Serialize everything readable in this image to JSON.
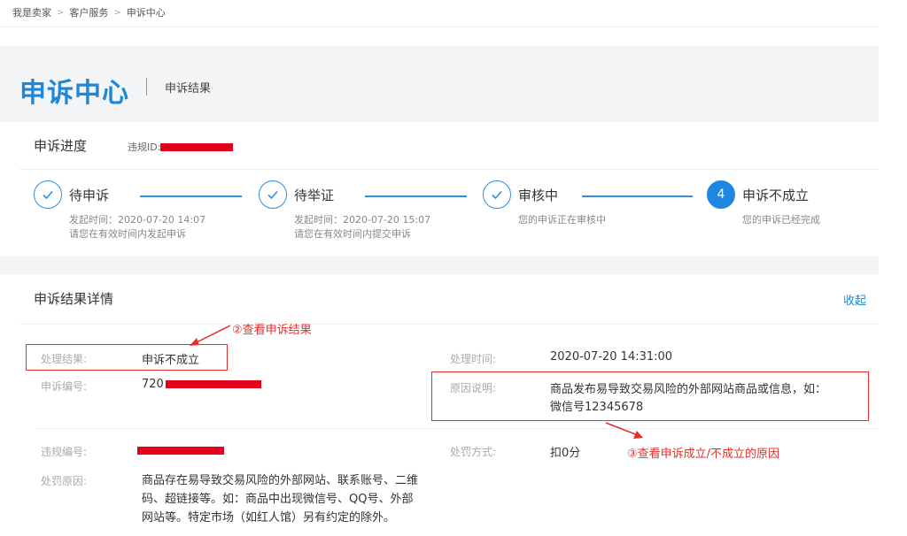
{
  "breadcrumb": {
    "items": [
      "我是卖家",
      "客户服务",
      "申诉中心"
    ],
    "separator": ">"
  },
  "header": {
    "title": "申诉中心",
    "subtitle": "申诉结果"
  },
  "progress": {
    "title": "申诉进度",
    "violation_id_label": "违规ID:",
    "steps": [
      {
        "name": "待申诉",
        "line1": "发起时间：2020-07-20 14:07",
        "line2": "请您在有效时间内发起申诉"
      },
      {
        "name": "待举证",
        "line1": "发起时间：2020-07-20 15:07",
        "line2": "请您在有效时间内提交申诉"
      },
      {
        "name": "审核中",
        "line1": "您的申诉正在审核中",
        "line2": ""
      },
      {
        "name": "申诉不成立",
        "number": "4",
        "line1": "您的申诉已经完成",
        "line2": ""
      }
    ]
  },
  "detail": {
    "title": "申诉结果详情",
    "collapse_label": "收起",
    "result_label": "处理结果:",
    "result_value": "申诉不成立",
    "time_label": "处理时间:",
    "time_value": "2020-07-20 14:31:00",
    "appeal_no_label": "申诉编号:",
    "appeal_no_value": "720",
    "reason_label": "原因说明:",
    "reason_line1": "商品发布易导致交易风险的外部网站商品或信息，如：",
    "reason_line2": "微信号12345678",
    "violation_no_label": "违规编号:",
    "penalty_method_label": "处罚方式:",
    "penalty_method_value": "扣0分",
    "penalty_reason_label": "处罚原因:",
    "penalty_reason_lines": [
      "商品存在易导致交易风险的外部网站、联系账号、二维",
      "码、超链接等。如：商品中出现微信号、QQ号、外部",
      "网站等。特定市场（如红人馆）另有约定的除外。"
    ]
  },
  "annotations": {
    "note2": "②查看申诉结果",
    "note3": "③查看申诉成立/不成立的原因",
    "color": "#e3302d"
  },
  "colors": {
    "accent": "#1f87d8",
    "redaction": "#e3001b"
  }
}
